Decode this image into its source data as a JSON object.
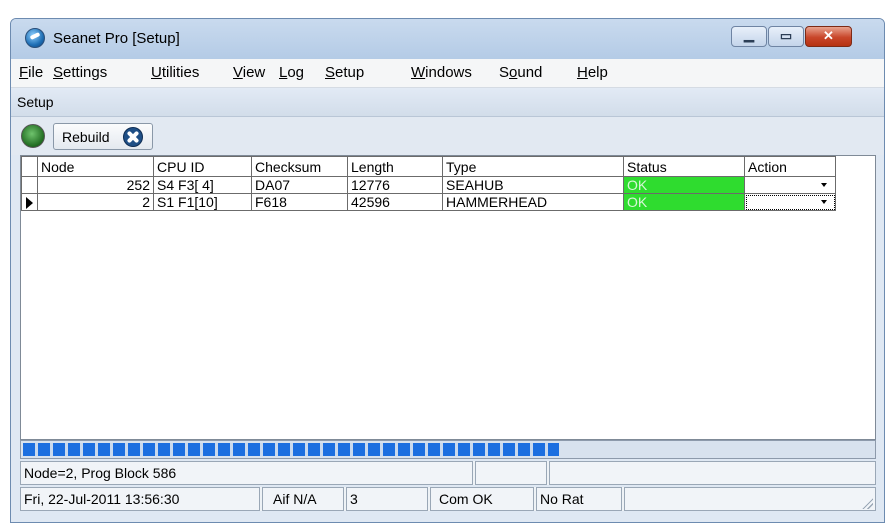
{
  "window": {
    "title": "Seanet Pro [Setup]"
  },
  "menu": [
    {
      "pre": "",
      "u": "F",
      "post": "ile"
    },
    {
      "pre": "",
      "u": "S",
      "post": "ettings"
    },
    {
      "pre": "",
      "u": "U",
      "post": "tilities"
    },
    {
      "pre": "",
      "u": "V",
      "post": "iew"
    },
    {
      "pre": "",
      "u": "L",
      "post": "og"
    },
    {
      "pre": "",
      "u": "S",
      "post": "etup"
    },
    {
      "pre": "",
      "u": "W",
      "post": "indows"
    },
    {
      "pre": "S",
      "u": "o",
      "post": "und"
    },
    {
      "pre": "",
      "u": "H",
      "post": "elp"
    }
  ],
  "subbar": {
    "label": "Setup"
  },
  "toolbar": {
    "rebuild_label": "Rebuild"
  },
  "grid": {
    "headers": [
      "Node",
      "CPU ID",
      "Checksum",
      "Length",
      "Type",
      "Status",
      "Action"
    ],
    "rows": [
      {
        "node": "252",
        "cpu": "S4 F3[ 4]",
        "checksum": "DA07",
        "length": "12776",
        "type": "SEAHUB",
        "status": "OK",
        "action": ""
      },
      {
        "node": "2",
        "cpu": "S1 F1[10]",
        "checksum": "F618",
        "length": "42596",
        "type": "HAMMERHEAD",
        "status": "OK",
        "action": ""
      }
    ]
  },
  "progress": {
    "fraction": 0.63
  },
  "status_bar": {
    "message": "Node=2, Prog Block 586",
    "extra1": "",
    "extra2": "",
    "datetime": "Fri, 22-Jul-2011 13:56:30",
    "aif": "Aif N/A",
    "count": "3",
    "com": "Com OK",
    "rat": "No Rat",
    "last": ""
  },
  "colors": {
    "status_ok": "#2fdc2f",
    "progress": "#1c6fe0",
    "close_button": "#c8462a"
  },
  "icons": [
    "app-globe-icon",
    "minimize-icon",
    "maximize-icon",
    "close-icon",
    "run-indicator-icon",
    "fan-icon",
    "row-pointer-icon",
    "dropdown-arrow-icon",
    "resize-grip-icon"
  ]
}
